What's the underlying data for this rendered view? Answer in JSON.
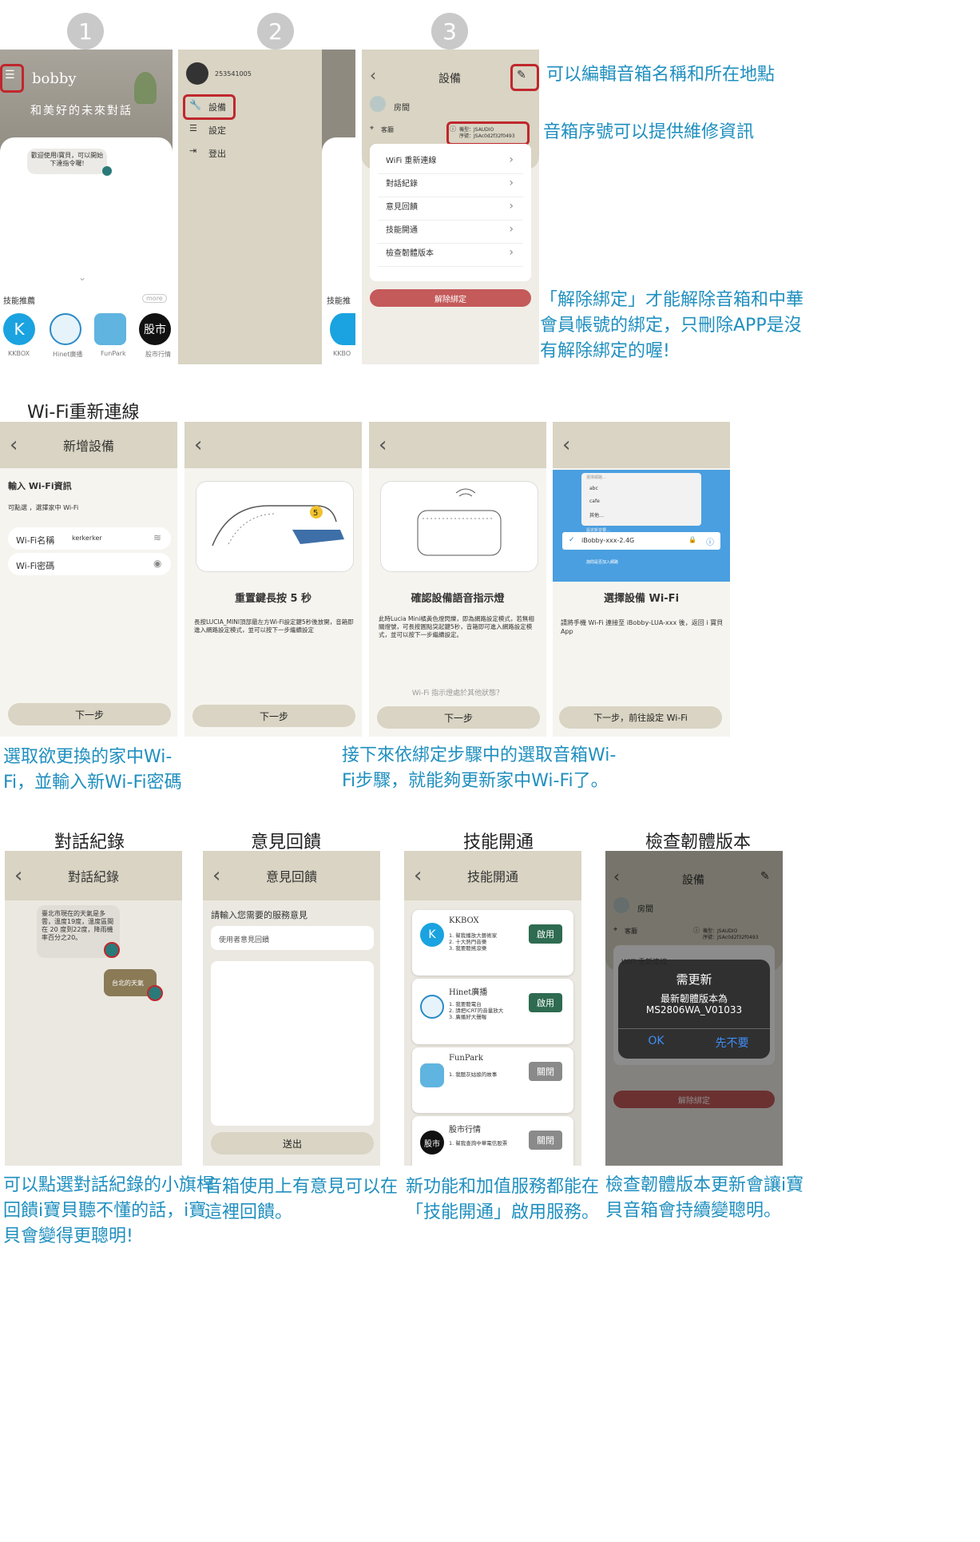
{
  "steps": [
    "1",
    "2",
    "3"
  ],
  "screen1": {
    "brand": "bobby",
    "slogan": "和美好的未來對話",
    "welcome": "歡迎使用i寶貝，可以開始下達指令囉!",
    "skills_title": "技能推薦",
    "more": "more",
    "apps": [
      "KKBOX",
      "Hinet廣播",
      "FunPark",
      "股市行情"
    ]
  },
  "screen2": {
    "user_id": "253541005",
    "menu": [
      "設備",
      "設定",
      "登出"
    ],
    "partial_label": "技能推",
    "partial_app": "KKBO"
  },
  "screen3": {
    "title": "設備",
    "room": "房間",
    "location": "客廳",
    "model": "機型：JSAUDIO",
    "serial": "序號：JSAc0d2f32f0493",
    "menu": [
      "WiFi 重新連線",
      "對話紀錄",
      "意見回饋",
      "技能開通",
      "檢查韌體版本"
    ],
    "unbind": "解除綁定"
  },
  "notes_top": {
    "edit": "可以編輯音箱名稱和所在地點",
    "serial": "音箱序號可以提供維修資訊",
    "unbind_line1": "「解除綁定」才能解除音箱和中華",
    "unbind_line2": "會員帳號的綁定，只刪除APP是沒",
    "unbind_line3": "有解除綁定的喔!"
  },
  "wifi_section": {
    "title": "Wi-Fi重新連線",
    "s1": {
      "header": "新增設備",
      "heading": "輸入 Wi-Fi資訊",
      "hint": "可點選    ，選擇家中 Wi-Fi",
      "name_label": "Wi-Fi名稱",
      "name_value": "kerkerker",
      "pwd_label": "Wi-Fi密碼",
      "next": "下一步"
    },
    "s2": {
      "title": "重置鍵長按 5 秒",
      "desc": "長按LUCIA_MINI頂部最左方Wi-Fi設定鍵5秒後放開，音箱即進入網路設定模式，並可以按下一步繼續設定",
      "badge": "5",
      "next": "下一步"
    },
    "s3": {
      "title": "確認設備語音指示燈",
      "desc": "此時Lucia Mini橘黃色燈閃爍，即為網路設定模式，若無相關燈號，可長按圓點突起鍵5秒，音箱即可進入網路設定模式，並可以按下一步繼續設定。",
      "other": "Wi-Fi 指示燈處於其他狀態？",
      "next": "下一步"
    },
    "s4": {
      "title": "選擇設備 Wi-Fi",
      "desc": "請將手機 Wi-Fi 連接至 iBobby-LUA-xxx 後，返回 i 寶貝 App",
      "list_header": "選擇網路…",
      "networks": [
        "abc",
        "cafe",
        "其他…"
      ],
      "device_header": "設定新音響…",
      "selected": "iBobby-xxx-2.4G",
      "ask": "詢問是否加入網路",
      "next": "下一步，前往設定 Wi-Fi"
    },
    "note_left_1": "選取欲更換的家中Wi-",
    "note_left_2": "Fi，並輸入新Wi-Fi密碼",
    "note_right_1": "接下來依綁定步驟中的選取音箱Wi-",
    "note_right_2": "Fi步驟，就能夠更新家中Wi-Fi了。"
  },
  "bottom": {
    "history": {
      "title": "對話紀錄",
      "header": "對話紀錄",
      "bubble": "臺北市現在的天氣是多雲，溫度19度，溫度區間在 20 度到22度，降雨機率百分之20。",
      "user_msg": "台北的天氣",
      "note": [
        "可以點選對話紀錄的小旗桿",
        "回饋i寶貝聽不懂的話，i寶",
        "貝會變得更聰明!"
      ]
    },
    "feedback": {
      "title": "意見回饋",
      "header": "意見回饋",
      "prompt": "請輸入您需要的服務意見",
      "placeholder": "使用者意見回饋",
      "submit": "送出",
      "note": [
        "音箱使用上有意見可以在",
        "這裡回饋。"
      ]
    },
    "skills": {
      "title": "技能開通",
      "header": "技能開通",
      "cards": [
        {
          "name": "KKBOX",
          "items": [
            "1. 幫我播放大藝術家",
            "2. 十大熱門音樂",
            "3. 我要聽搖滾樂"
          ],
          "state": "啟用",
          "color": "#2e6b50"
        },
        {
          "name": "Hinet廣播",
          "items": [
            "1. 我要聽電台",
            "2. 請把ICRT的音量放大",
            "3. 廣播好大聲喔"
          ],
          "state": "啟用",
          "color": "#2e6b50"
        },
        {
          "name": "FunPark",
          "items": [
            "1. 我聽灰姑娘的故事"
          ],
          "state": "關閉",
          "color": "#8a8a8a"
        },
        {
          "name": "股市行情",
          "items": [
            "1. 幫我查詢中華電信股票"
          ],
          "state": "關閉",
          "color": "#8a8a8a"
        }
      ],
      "note": [
        "新功能和加值服務都能在",
        "「技能開通」啟用服務。"
      ]
    },
    "firmware": {
      "title": "檢查韌體版本",
      "header": "設備",
      "room": "房間",
      "location": "客廳",
      "model": "機型：JSAUDIO",
      "serial": "序號：JSAc0d2f32f0493",
      "menu_partial": "WiFi 重新連線",
      "dialog_title": "需更新",
      "dialog_line1": "最新韌體版本為",
      "dialog_line2": "MS2806WA_V01033",
      "ok": "OK",
      "later": "先不要",
      "unbind": "解除綁定",
      "note": [
        "檢查韌體版本更新會讓i寶",
        "貝音箱會持續變聰明。"
      ]
    }
  },
  "colors": {
    "accent_blue": "#1f8fbf",
    "beige": "#d9d4c3",
    "red": "#c0272d",
    "unbind": "#c45a5a"
  }
}
